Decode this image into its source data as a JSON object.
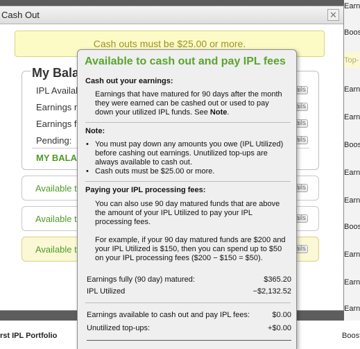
{
  "background": {
    "right_items": [
      "Earnin",
      "Boost",
      "Top-",
      "Earnin",
      "Earnin",
      "Boost",
      "Earnin",
      "Earnin",
      "Boost",
      "Earnin",
      "Earnin",
      "Earnin",
      "Earnin"
    ],
    "bottom_left": "rst IPL Portfolio",
    "bottom_right": "Boost"
  },
  "dialog": {
    "title": "Cash Out",
    "close_glyph": "✕",
    "alert": "Cash outs must be $25.00 or more.",
    "balance": {
      "legend": "My Balan",
      "rows": [
        "IPL Availab",
        "Earnings m",
        "Earnings fu",
        "Pending:"
      ],
      "total": "MY BALA",
      "details_label": "ails"
    },
    "options": [
      {
        "label": "Available t",
        "details_label": "ails"
      },
      {
        "label": "Available t",
        "details_label": "ails"
      },
      {
        "label": "Available t",
        "details_label": "ails"
      }
    ]
  },
  "tooltip": {
    "title": "Available to cash out and pay IPL fees",
    "cash_out_heading": "Cash out your earnings:",
    "cash_out_text_pre": "Earnings that have matured for 90 days after the month they were earned can be cashed out or used to pay down your utilized IPL funds. See ",
    "cash_out_text_bold": "Note",
    "cash_out_text_post": ".",
    "note_heading": "Note:",
    "notes": [
      "You must pay down any amounts you owe (IPL Utilized) before cashing out earnings. Unutilized top-ups are always available to cash out.",
      "Cash outs must be $25.00 or more."
    ],
    "fees_heading": "Paying your IPL processing fees:",
    "fees_text_1": "You can also use 90 day matured funds that are above the amount of your IPL Utilized to pay your IPL processing fees.",
    "fees_text_2": "For example, if your 90 day matured funds are $200 and your IPL Utilized is $150, then you can spend up to $50 on your IPL processing fees ($200 − $150 = $50).",
    "summary": [
      {
        "label": "Earnings fully (90 day) matured:",
        "value": "$365.20"
      },
      {
        "label": "IPL Utilized",
        "value": "−$2,132.52"
      }
    ],
    "totals": [
      {
        "label": "Earnings available to cash out and pay IPL fees:",
        "value": "$0.00"
      },
      {
        "label": "Unutilized top-ups:",
        "value": "+$0.00"
      }
    ]
  }
}
